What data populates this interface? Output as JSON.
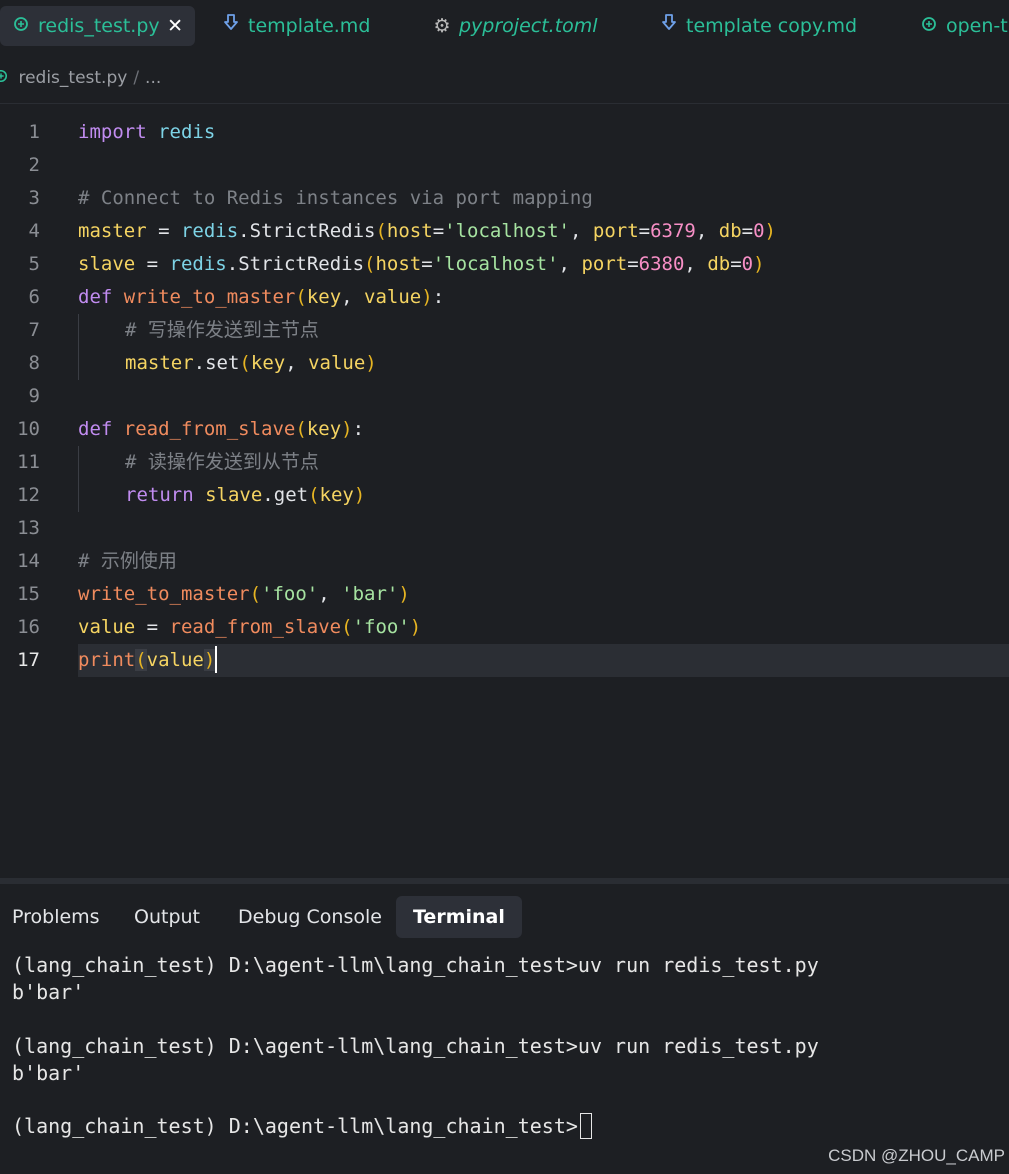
{
  "tabs": [
    {
      "label": "redis_test.py",
      "icon": "python-icon",
      "active": true,
      "close": "✕"
    },
    {
      "label": "template.md",
      "icon": "download-icon"
    },
    {
      "label": "pyproject.toml",
      "icon": "gear-icon",
      "italic": true
    },
    {
      "label": "template copy.md",
      "icon": "download-icon"
    },
    {
      "label": "open-t",
      "icon": "python-icon"
    }
  ],
  "breadcrumb": {
    "file": "redis_test.py",
    "separator": "/",
    "rest": "..."
  },
  "editor": {
    "line_numbers": [
      "1",
      "2",
      "3",
      "4",
      "5",
      "6",
      "7",
      "8",
      "9",
      "10",
      "11",
      "12",
      "13",
      "14",
      "15",
      "16",
      "17"
    ],
    "current_line": 17,
    "lines": {
      "l1": {
        "kw": "import",
        "mod": "redis"
      },
      "l3": {
        "comment": "# Connect to Redis instances via port mapping"
      },
      "l4": {
        "var": "master",
        "eq": " = ",
        "mod": "redis",
        "dot": ".",
        "cls": "StrictRedis",
        "open": "(",
        "k1": "host",
        "e1": "=",
        "s1": "'localhost'",
        "c1": ", ",
        "k2": "port",
        "e2": "=",
        "n1": "6379",
        "c2": ", ",
        "k3": "db",
        "e3": "=",
        "n2": "0",
        "close": ")"
      },
      "l5": {
        "var": "slave",
        "eq": " = ",
        "mod": "redis",
        "dot": ".",
        "cls": "StrictRedis",
        "open": "(",
        "k1": "host",
        "e1": "=",
        "s1": "'localhost'",
        "c1": ", ",
        "k2": "port",
        "e2": "=",
        "n1": "6380",
        "c2": ", ",
        "k3": "db",
        "e3": "=",
        "n2": "0",
        "close": ")"
      },
      "l6": {
        "kw": "def",
        "fn": "write_to_master",
        "open": "(",
        "p1": "key",
        "c": ", ",
        "p2": "value",
        "close": ")",
        "colon": ":"
      },
      "l7": {
        "comment": "# 写操作发送到主节点"
      },
      "l8": {
        "var": "master",
        "dot": ".",
        "meth": "set",
        "open": "(",
        "p1": "key",
        "c": ", ",
        "p2": "value",
        "close": ")"
      },
      "l10": {
        "kw": "def",
        "fn": "read_from_slave",
        "open": "(",
        "p1": "key",
        "close": ")",
        "colon": ":"
      },
      "l11": {
        "comment": "# 读操作发送到从节点"
      },
      "l12": {
        "kw": "return",
        "var": "slave",
        "dot": ".",
        "meth": "get",
        "open": "(",
        "p1": "key",
        "close": ")"
      },
      "l14": {
        "comment": "# 示例使用"
      },
      "l15": {
        "fn": "write_to_master",
        "open": "(",
        "s1": "'foo'",
        "c": ", ",
        "s2": "'bar'",
        "close": ")"
      },
      "l16": {
        "var": "value",
        "eq": " = ",
        "fn": "read_from_slave",
        "open": "(",
        "s1": "'foo'",
        "close": ")"
      },
      "l17": {
        "fn": "print",
        "open": "(",
        "var": "value",
        "close": ")"
      }
    }
  },
  "panel": {
    "tabs": [
      "Problems",
      "Output",
      "Debug Console",
      "Terminal"
    ],
    "active_tab": "Terminal",
    "terminal": {
      "cmd1": "(lang_chain_test) D:\\agent-llm\\lang_chain_test>uv run redis_test.py",
      "out1": "b'bar'",
      "cmd2": "(lang_chain_test) D:\\agent-llm\\lang_chain_test>uv run redis_test.py",
      "out2": "b'bar'",
      "prompt": "(lang_chain_test) D:\\agent-llm\\lang_chain_test>"
    }
  },
  "watermark": "CSDN @ZHOU_CAMP",
  "colors": {
    "accent": "#2bbf98",
    "background": "#1d1f23",
    "tab_active": "#2d3038"
  }
}
